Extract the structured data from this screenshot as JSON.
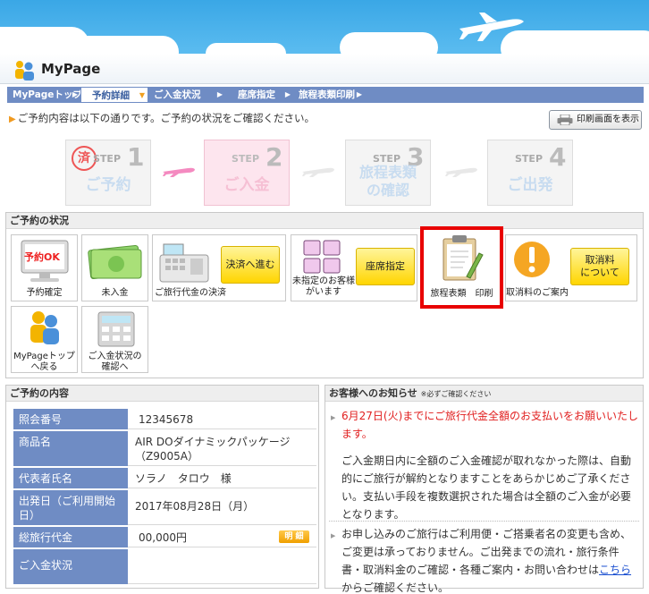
{
  "header": {
    "title": "MyPage"
  },
  "nav": [
    {
      "label": "MyPageトップ",
      "active": false
    },
    {
      "label": "予約詳細",
      "active": true
    },
    {
      "label": "ご入金状況",
      "active": false
    },
    {
      "label": "座席指定",
      "active": false
    },
    {
      "label": "旅程表類印刷",
      "active": false
    }
  ],
  "intro": "ご予約内容は以下の通りです。ご予約の状況をご確認ください。",
  "print_button": "印刷画面を表示",
  "steps": [
    {
      "word": "STEP",
      "num": "1",
      "label": "ご予約"
    },
    {
      "word": "STEP",
      "num": "2",
      "label": "ご入金"
    },
    {
      "word": "STEP",
      "num": "3",
      "label_line1": "旅程表類",
      "label_line2": "の確認"
    },
    {
      "word": "STEP",
      "num": "4",
      "label": "ご出発"
    }
  ],
  "status_panel": {
    "title": "ご予約の状況",
    "tiles": {
      "confirmed": {
        "screen": "予約OK",
        "caption": "予約確定"
      },
      "unpaid": {
        "caption": "未入金"
      },
      "payment": {
        "caption": "ご旅行代金の決済",
        "button": "決済へ進む"
      },
      "seat": {
        "caption_line1": "未指定のお客様",
        "caption_line2": "がいます",
        "button": "座席指定"
      },
      "itinerary": {
        "caption": "旅程表類　印刷"
      },
      "cancel": {
        "caption": "取消料のご案内",
        "button_line1": "取消料",
        "button_line2": "について"
      },
      "mypage_top": {
        "caption_line1": "MyPageトップ",
        "caption_line2": "へ戻る"
      },
      "payment_status": {
        "caption_line1": "ご入金状況の",
        "caption_line2": "確認へ"
      }
    }
  },
  "booking": {
    "title": "ご予約の内容",
    "rows": [
      {
        "key": "照会番号",
        "value": "12345678"
      },
      {
        "key": "商品名",
        "value_line1": "AIR DOダイナミックパッケージ",
        "value_line2": "（Z9005A）"
      },
      {
        "key": "代表者氏名",
        "value": "ソラノ　タロウ　様"
      },
      {
        "key_line1": "出発日（ご利用開始",
        "key_line2": "日）",
        "value": "2017年08月28日（月）"
      },
      {
        "key": "総旅行代金",
        "value": "00,000円",
        "badge": "明 細"
      },
      {
        "key": "ご入金状況",
        "value": ""
      }
    ]
  },
  "notices": {
    "title": "お客様へのお知らせ",
    "title_note": "※必ずご確認ください",
    "blocks": [
      {
        "red": "6月27日(火)までにご旅行代金全額のお支払いをお願いいたします。",
        "text": "ご入金期日内に全額のご入金確認が取れなかった際は、自動的にご旅行が解約となりますことをあらかじめご了承ください。支払い手段を複数選択された場合は全額のご入金が必要となります。"
      },
      {
        "text_before": "お申し込みのご旅行はご利用便・ご搭乗者名の変更も含め、ご変更は承っておりません。ご出発までの流れ・旅行条件書・取消料金のご確認・各種ご案内・お問い合わせは",
        "link": "こちら",
        "text_after": "からご確認ください。"
      }
    ]
  },
  "colors": {
    "accent": "#6f8cc4",
    "sky": "#3aa7e6",
    "highlight": "#e80000",
    "button": "#ffd500",
    "alert": "#e12020"
  }
}
